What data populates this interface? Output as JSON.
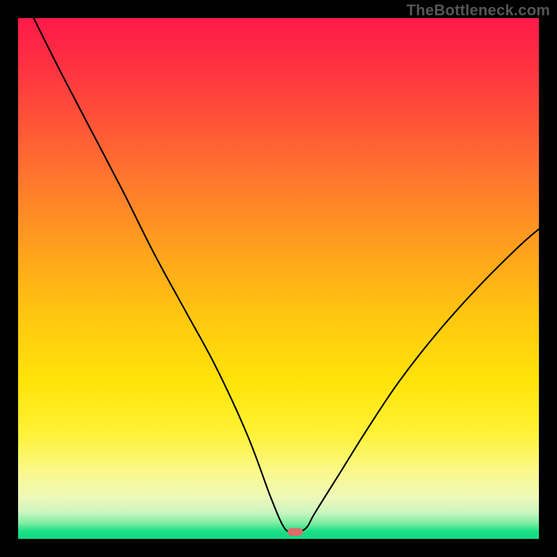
{
  "watermark_text": "TheBottleneck.com",
  "colors": {
    "page_bg": "#000000",
    "watermark": "#555555",
    "curve_stroke": "#000000",
    "marker": "#e26a6a",
    "gradient_top": "#ff1a49",
    "gradient_bottom": "#0fd985"
  },
  "chart_data": {
    "type": "line",
    "title": "",
    "xlabel": "",
    "ylabel": "",
    "xlim": [
      0,
      100
    ],
    "ylim": [
      0,
      100
    ],
    "grid": false,
    "legend": false,
    "series": [
      {
        "name": "bottleneck-curve",
        "x": [
          3,
          8,
          14,
          20,
          26,
          32,
          38,
          44,
          48.5,
          51,
          52.5,
          54,
          55.5,
          57,
          62,
          67,
          73,
          80,
          88,
          96,
          100
        ],
        "y": [
          100,
          90,
          78.5,
          67,
          55,
          44,
          33,
          20,
          8,
          2.3,
          1.4,
          1.4,
          2.3,
          5,
          13,
          21,
          30,
          39,
          48,
          56,
          59.5
        ]
      }
    ],
    "annotations": [
      {
        "name": "min-marker",
        "x": 53.2,
        "y": 1.4
      }
    ]
  }
}
